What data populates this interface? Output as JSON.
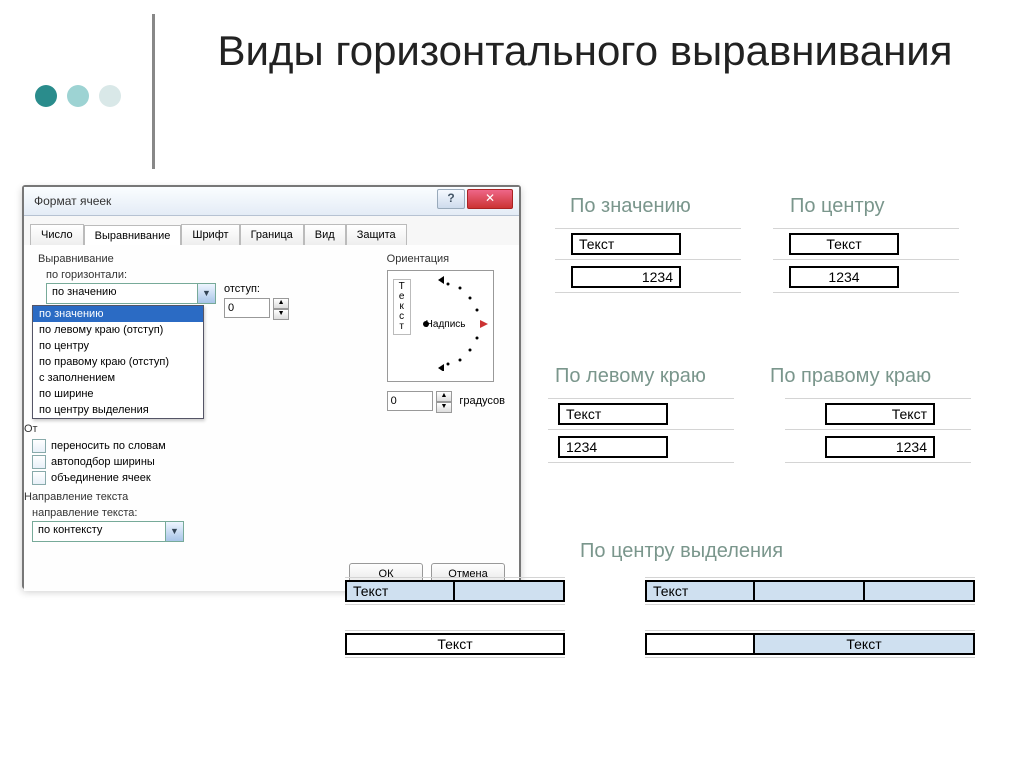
{
  "heading": "Виды горизонтального выравнивания",
  "dialog": {
    "title": "Формат ячеек",
    "help_icon": "?",
    "close_icon": "✕",
    "tabs": [
      "Число",
      "Выравнивание",
      "Шрифт",
      "Граница",
      "Вид",
      "Защита"
    ],
    "alignment_section": "Выравнивание",
    "horiz_label": "по горизонтали:",
    "horiz_value": "по значению",
    "horiz_options": [
      "по значению",
      "по левому краю (отступ)",
      "по центру",
      "по правому краю (отступ)",
      "с заполнением",
      "по ширине",
      "по центру выделения"
    ],
    "indent_label": "отступ:",
    "indent_value": "0",
    "orientation_label": "Ориентация",
    "vert_text": "Т\nе\nк\nс\nт",
    "arc_label": "Надпись",
    "degrees_value": "0",
    "degrees_label": "градусов",
    "display_section": "От",
    "chk_wrap": "переносить по словам",
    "chk_shrink": "автоподбор ширины",
    "chk_merge": "объединение ячеек",
    "text_dir_section": "Направление текста",
    "text_dir_label": "направление текста:",
    "text_dir_value": "по контексту",
    "ok": "ОК",
    "cancel": "Отмена"
  },
  "labels": {
    "by_value": "По значению",
    "by_center": "По центру",
    "by_left": "По левому краю",
    "by_right": "По правому краю",
    "by_sel": "По центру выделения"
  },
  "sample": {
    "text": "Текст",
    "num": "1234"
  }
}
